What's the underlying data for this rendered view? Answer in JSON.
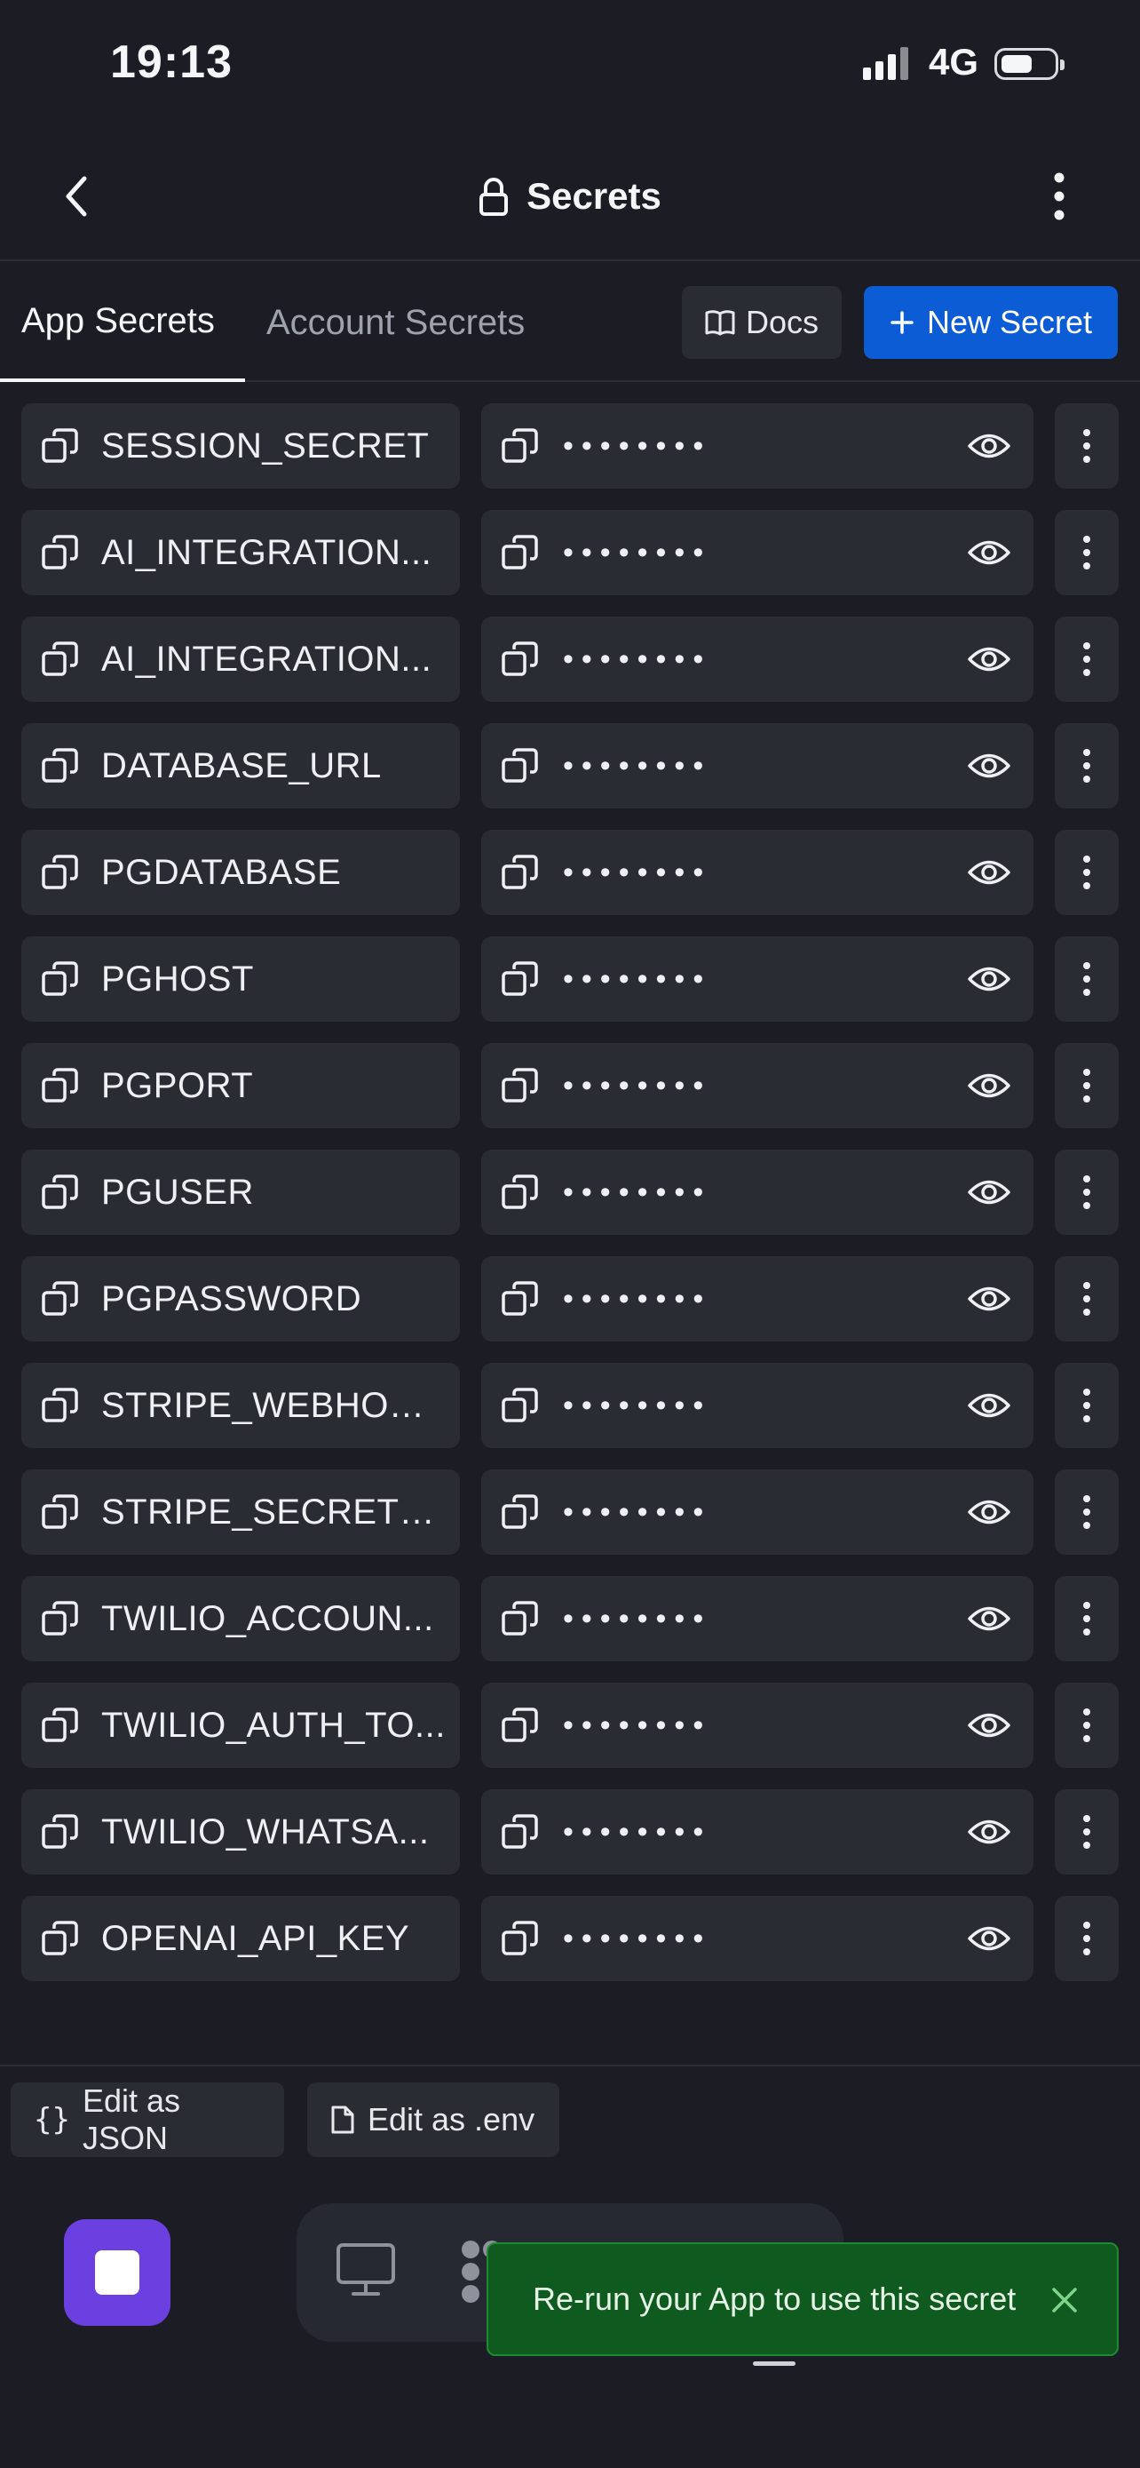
{
  "status_bar": {
    "time": "19:13",
    "network": "4G"
  },
  "header": {
    "title": "Secrets"
  },
  "tabs": [
    {
      "label": "App Secrets"
    },
    {
      "label": "Account Secrets"
    }
  ],
  "toolbar": {
    "docs_label": "Docs",
    "new_secret_label": "New Secret"
  },
  "secrets": [
    {
      "key": "SESSION_SECRET",
      "value": "••••••••"
    },
    {
      "key": "AI_INTEGRATION...",
      "value": "••••••••"
    },
    {
      "key": "AI_INTEGRATION...",
      "value": "••••••••"
    },
    {
      "key": "DATABASE_URL",
      "value": "••••••••"
    },
    {
      "key": "PGDATABASE",
      "value": "••••••••"
    },
    {
      "key": "PGHOST",
      "value": "••••••••"
    },
    {
      "key": "PGPORT",
      "value": "••••••••"
    },
    {
      "key": "PGUSER",
      "value": "••••••••"
    },
    {
      "key": "PGPASSWORD",
      "value": "••••••••"
    },
    {
      "key": "STRIPE_WEBHOO...",
      "value": "••••••••"
    },
    {
      "key": "STRIPE_SECRET_...",
      "value": "••••••••"
    },
    {
      "key": "TWILIO_ACCOUN...",
      "value": "••••••••"
    },
    {
      "key": "TWILIO_AUTH_TO...",
      "value": "••••••••"
    },
    {
      "key": "TWILIO_WHATSA...",
      "value": "••••••••"
    },
    {
      "key": "OPENAI_API_KEY",
      "value": "••••••••"
    }
  ],
  "edit_bar": {
    "json_label": "Edit as JSON",
    "env_label": "Edit as .env"
  },
  "toast": {
    "message": "Re-run your App to use this secret"
  },
  "colors": {
    "background": "#1c1d24",
    "cell": "#2a2c34",
    "primary": "#0b5cd5",
    "stop": "#6b3fe0",
    "toast": "#0f5a1e"
  }
}
